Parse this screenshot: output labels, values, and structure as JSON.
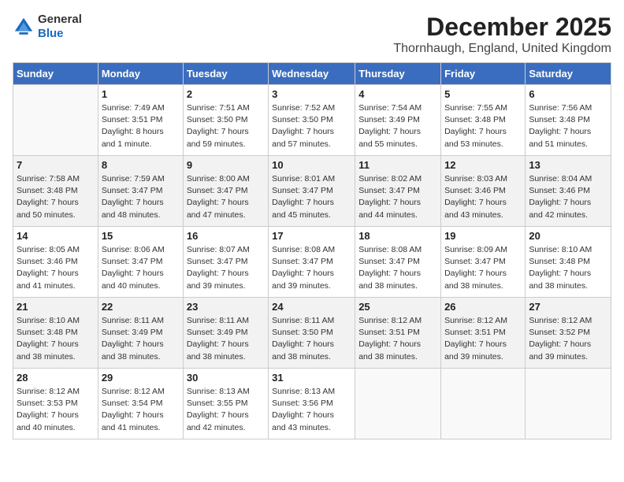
{
  "header": {
    "logo_general": "General",
    "logo_blue": "Blue",
    "main_title": "December 2025",
    "sub_title": "Thornhaugh, England, United Kingdom"
  },
  "calendar": {
    "days_of_week": [
      "Sunday",
      "Monday",
      "Tuesday",
      "Wednesday",
      "Thursday",
      "Friday",
      "Saturday"
    ],
    "weeks": [
      [
        {
          "day": "",
          "info": ""
        },
        {
          "day": "1",
          "info": "Sunrise: 7:49 AM\nSunset: 3:51 PM\nDaylight: 8 hours\nand 1 minute."
        },
        {
          "day": "2",
          "info": "Sunrise: 7:51 AM\nSunset: 3:50 PM\nDaylight: 7 hours\nand 59 minutes."
        },
        {
          "day": "3",
          "info": "Sunrise: 7:52 AM\nSunset: 3:50 PM\nDaylight: 7 hours\nand 57 minutes."
        },
        {
          "day": "4",
          "info": "Sunrise: 7:54 AM\nSunset: 3:49 PM\nDaylight: 7 hours\nand 55 minutes."
        },
        {
          "day": "5",
          "info": "Sunrise: 7:55 AM\nSunset: 3:48 PM\nDaylight: 7 hours\nand 53 minutes."
        },
        {
          "day": "6",
          "info": "Sunrise: 7:56 AM\nSunset: 3:48 PM\nDaylight: 7 hours\nand 51 minutes."
        }
      ],
      [
        {
          "day": "7",
          "info": "Sunrise: 7:58 AM\nSunset: 3:48 PM\nDaylight: 7 hours\nand 50 minutes."
        },
        {
          "day": "8",
          "info": "Sunrise: 7:59 AM\nSunset: 3:47 PM\nDaylight: 7 hours\nand 48 minutes."
        },
        {
          "day": "9",
          "info": "Sunrise: 8:00 AM\nSunset: 3:47 PM\nDaylight: 7 hours\nand 47 minutes."
        },
        {
          "day": "10",
          "info": "Sunrise: 8:01 AM\nSunset: 3:47 PM\nDaylight: 7 hours\nand 45 minutes."
        },
        {
          "day": "11",
          "info": "Sunrise: 8:02 AM\nSunset: 3:47 PM\nDaylight: 7 hours\nand 44 minutes."
        },
        {
          "day": "12",
          "info": "Sunrise: 8:03 AM\nSunset: 3:46 PM\nDaylight: 7 hours\nand 43 minutes."
        },
        {
          "day": "13",
          "info": "Sunrise: 8:04 AM\nSunset: 3:46 PM\nDaylight: 7 hours\nand 42 minutes."
        }
      ],
      [
        {
          "day": "14",
          "info": "Sunrise: 8:05 AM\nSunset: 3:46 PM\nDaylight: 7 hours\nand 41 minutes."
        },
        {
          "day": "15",
          "info": "Sunrise: 8:06 AM\nSunset: 3:47 PM\nDaylight: 7 hours\nand 40 minutes."
        },
        {
          "day": "16",
          "info": "Sunrise: 8:07 AM\nSunset: 3:47 PM\nDaylight: 7 hours\nand 39 minutes."
        },
        {
          "day": "17",
          "info": "Sunrise: 8:08 AM\nSunset: 3:47 PM\nDaylight: 7 hours\nand 39 minutes."
        },
        {
          "day": "18",
          "info": "Sunrise: 8:08 AM\nSunset: 3:47 PM\nDaylight: 7 hours\nand 38 minutes."
        },
        {
          "day": "19",
          "info": "Sunrise: 8:09 AM\nSunset: 3:47 PM\nDaylight: 7 hours\nand 38 minutes."
        },
        {
          "day": "20",
          "info": "Sunrise: 8:10 AM\nSunset: 3:48 PM\nDaylight: 7 hours\nand 38 minutes."
        }
      ],
      [
        {
          "day": "21",
          "info": "Sunrise: 8:10 AM\nSunset: 3:48 PM\nDaylight: 7 hours\nand 38 minutes."
        },
        {
          "day": "22",
          "info": "Sunrise: 8:11 AM\nSunset: 3:49 PM\nDaylight: 7 hours\nand 38 minutes."
        },
        {
          "day": "23",
          "info": "Sunrise: 8:11 AM\nSunset: 3:49 PM\nDaylight: 7 hours\nand 38 minutes."
        },
        {
          "day": "24",
          "info": "Sunrise: 8:11 AM\nSunset: 3:50 PM\nDaylight: 7 hours\nand 38 minutes."
        },
        {
          "day": "25",
          "info": "Sunrise: 8:12 AM\nSunset: 3:51 PM\nDaylight: 7 hours\nand 38 minutes."
        },
        {
          "day": "26",
          "info": "Sunrise: 8:12 AM\nSunset: 3:51 PM\nDaylight: 7 hours\nand 39 minutes."
        },
        {
          "day": "27",
          "info": "Sunrise: 8:12 AM\nSunset: 3:52 PM\nDaylight: 7 hours\nand 39 minutes."
        }
      ],
      [
        {
          "day": "28",
          "info": "Sunrise: 8:12 AM\nSunset: 3:53 PM\nDaylight: 7 hours\nand 40 minutes."
        },
        {
          "day": "29",
          "info": "Sunrise: 8:12 AM\nSunset: 3:54 PM\nDaylight: 7 hours\nand 41 minutes."
        },
        {
          "day": "30",
          "info": "Sunrise: 8:13 AM\nSunset: 3:55 PM\nDaylight: 7 hours\nand 42 minutes."
        },
        {
          "day": "31",
          "info": "Sunrise: 8:13 AM\nSunset: 3:56 PM\nDaylight: 7 hours\nand 43 minutes."
        },
        {
          "day": "",
          "info": ""
        },
        {
          "day": "",
          "info": ""
        },
        {
          "day": "",
          "info": ""
        }
      ]
    ]
  }
}
